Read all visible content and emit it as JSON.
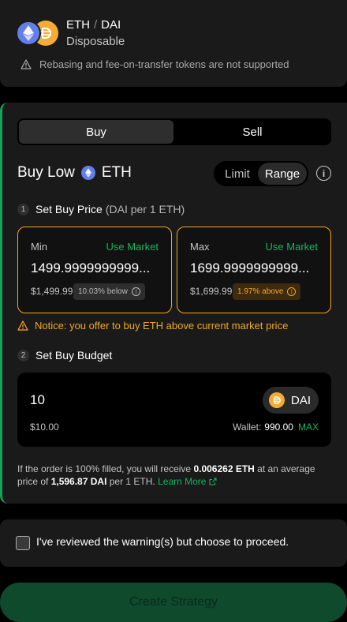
{
  "pair": {
    "base": "ETH",
    "separator": "/",
    "quote": "DAI",
    "strategy_type": "Disposable"
  },
  "top_warning": "Rebasing and fee-on-transfer tokens are not supported",
  "tabs": {
    "buy": "Buy",
    "sell": "Sell",
    "active": "Buy"
  },
  "heading": {
    "prefix": "Buy Low",
    "token": "ETH"
  },
  "mode": {
    "limit": "Limit",
    "range": "Range",
    "active": "Range"
  },
  "step1": {
    "num": "1",
    "title": "Set Buy Price",
    "sub": "(DAI per 1 ETH)"
  },
  "min": {
    "label": "Min",
    "use_market": "Use Market",
    "value": "1499.9999999999",
    "usd": "$1,499.99",
    "badge": "10.03% below"
  },
  "max": {
    "label": "Max",
    "use_market": "Use Market",
    "value": "1699.9999999999",
    "usd": "$1,699.99",
    "badge": "1.97% above"
  },
  "notice": "Notice: you offer to buy ETH above current market price",
  "step2": {
    "num": "2",
    "title": "Set Buy Budget"
  },
  "budget": {
    "value": "10",
    "token": "DAI",
    "usd": "$10.00",
    "wallet_label": "Wallet:",
    "wallet_amount": "990.00",
    "max": "MAX"
  },
  "summary": {
    "t1": "If the order is 100% filled, you will receive ",
    "receive": "0.006262 ETH",
    "t2": " at an average price of ",
    "avg": "1,596.87 DAI",
    "t3": " per 1 ETH. ",
    "learn": "Learn More"
  },
  "confirm_label": "I've reviewed the warning(s) but choose to proceed.",
  "create_label": "Create Strategy",
  "colors": {
    "accent_green": "#18b35f",
    "warning_orange": "#f5a623",
    "eth_blue": "#627eea",
    "dai_yellow": "#f5ac37"
  }
}
